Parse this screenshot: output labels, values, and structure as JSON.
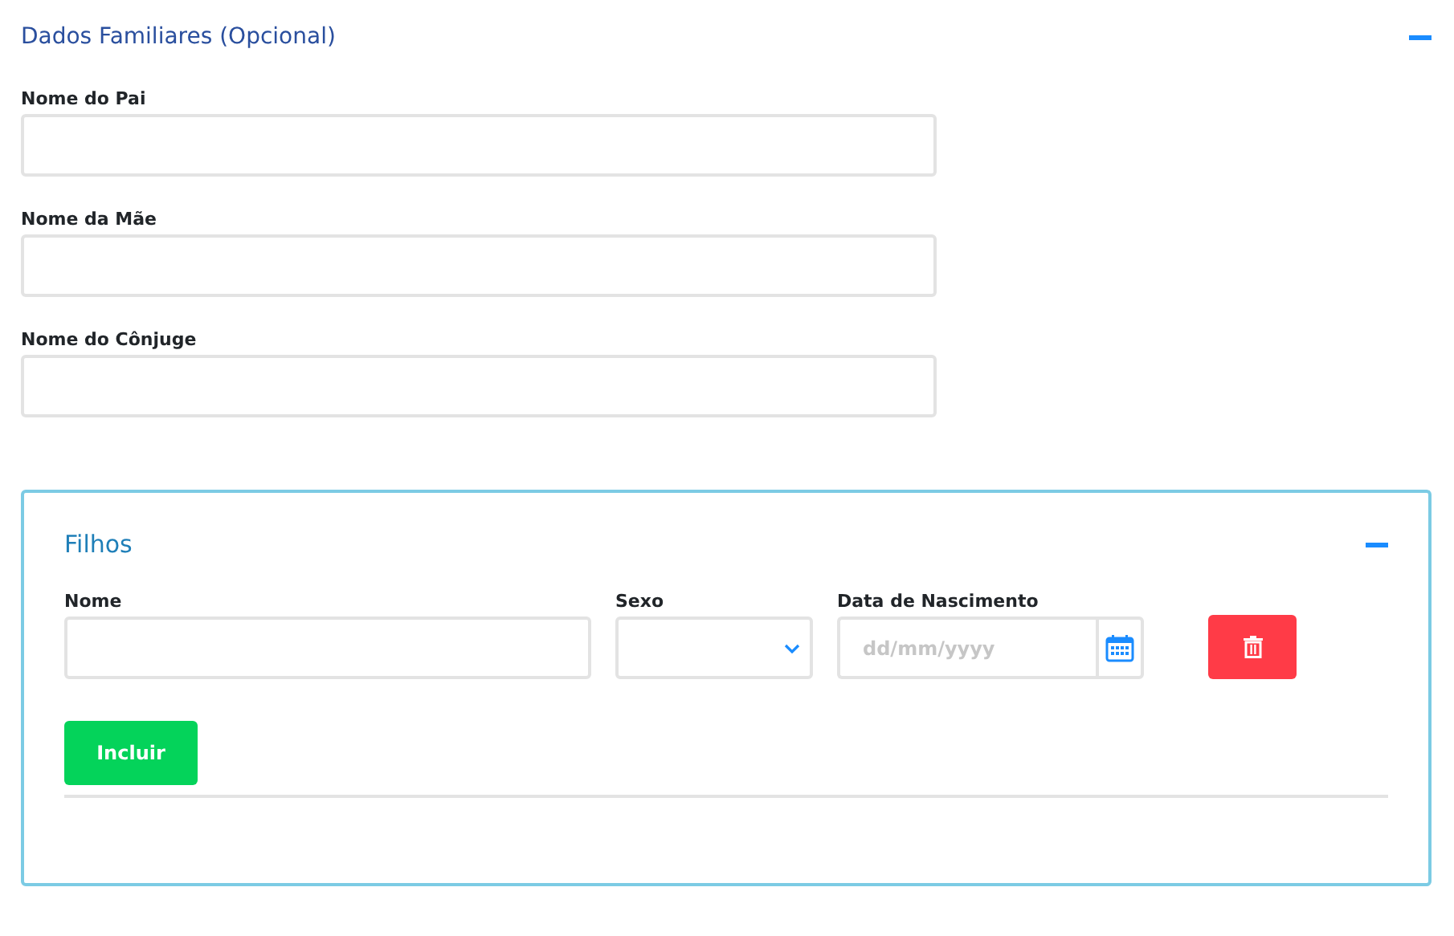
{
  "section": {
    "title": "Dados Familiares (Opcional)",
    "expanded": true
  },
  "fields": [
    {
      "label": "Nome do Pai"
    },
    {
      "label": "Nome da Mãe"
    },
    {
      "label": "Nome do Cônjuge"
    }
  ],
  "children_panel": {
    "title": "Filhos",
    "expanded": true,
    "columns": [
      {
        "label": "Nome"
      },
      {
        "label": "Sexo"
      },
      {
        "label": "Data de Nascimento"
      }
    ],
    "date_placeholder": "dd/mm/yyyy",
    "add_button": "Incluir"
  }
}
